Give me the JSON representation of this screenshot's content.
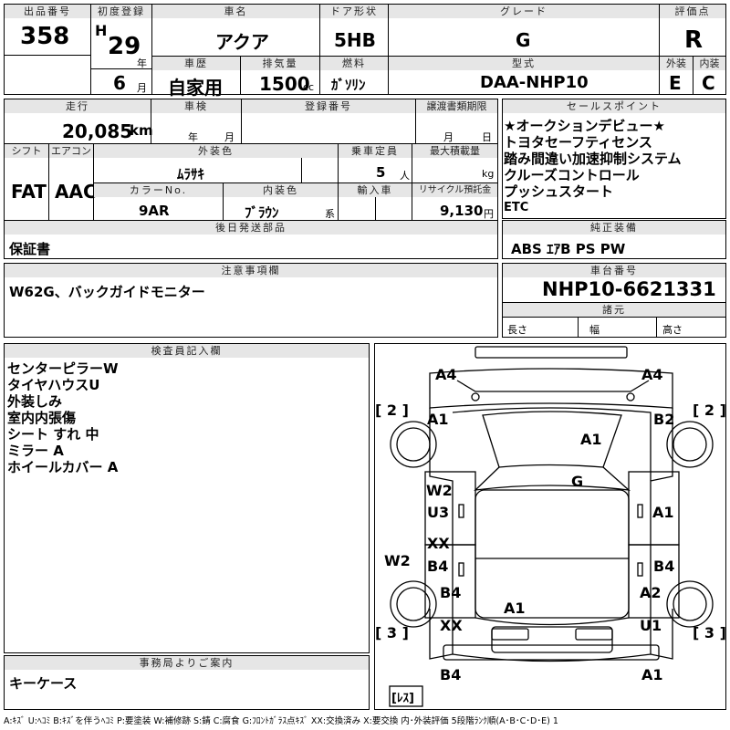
{
  "top": {
    "lot_label": "出品番号",
    "lot_value": "358",
    "first_reg_label": "初度登録",
    "era": "H",
    "year": "29",
    "year_unit": "年",
    "month": "6",
    "month_unit": "月",
    "car_name_label": "車名",
    "car_name": "アクア",
    "door_label": "ドア形状",
    "door": "5HB",
    "grade_label": "グレード",
    "grade": "G",
    "score_label": "評価点",
    "score": "R",
    "history_label": "車歴",
    "history": "自家用",
    "displacement_label": "排気量",
    "displacement": "1500",
    "displacement_unit": "cc",
    "fuel_label": "燃料",
    "fuel": "ｶﾞｿﾘﾝ",
    "model_label": "型式",
    "model": "DAA-NHP10",
    "exterior_label": "外装",
    "exterior": "E",
    "interior_label": "内装",
    "interior": "C"
  },
  "second": {
    "mileage_label": "走行",
    "mileage": "20,085",
    "mileage_unit": "km",
    "inspection_label": "車検",
    "inspection_year_unit": "年",
    "inspection_month_unit": "月",
    "reg_no_label": "登録番号",
    "transfer_label": "譲渡書類期限",
    "transfer_month_unit": "月",
    "transfer_day_unit": "日",
    "shift_label": "シフト",
    "shift": "FAT",
    "ac_label": "エアコン",
    "ac": "AAC",
    "ext_color_label": "外装色",
    "ext_color": "ﾑﾗｻｷ",
    "capacity_label": "乗車定員",
    "capacity": "5",
    "capacity_unit": "人",
    "max_load_label": "最大積載量",
    "max_load_unit": "kg",
    "color_no_label": "カラーNo.",
    "color_no": "9AR",
    "int_color_label": "内装色",
    "int_color": "ﾌﾞﾗｳﾝ",
    "int_color_unit": "系",
    "import_label": "輸入車",
    "recycle_label": "リサイクル預託金",
    "recycle": "9,130",
    "recycle_unit": "円",
    "later_label": "後日発送部品",
    "later": "保証書"
  },
  "sales": {
    "label": "セールスポイント",
    "lines": [
      "★オークションデビュー★",
      "トヨタセーフティセンス",
      "踏み間違い加速抑制システム",
      "クルーズコントロール",
      "プッシュスタート",
      "ETC"
    ]
  },
  "equipment": {
    "label": "純正装備",
    "value": "ABS ｴｱB PS PW"
  },
  "notes": {
    "label": "注意事項欄",
    "value": "W62G、バックガイドモニター"
  },
  "chassis": {
    "label": "車台番号",
    "value": "NHP10-6621331",
    "dim_label": "諸元",
    "length": "長さ",
    "width": "幅",
    "height": "高さ"
  },
  "inspector": {
    "label": "検査員記入欄",
    "lines": [
      "センターピラーW",
      "タイヤハウスU",
      "外装しみ",
      "室内内張傷",
      "シート すれ 中",
      "ミラー A",
      "ホイールカバー A"
    ]
  },
  "office": {
    "label": "事務局よりご案内",
    "value": "キーケース"
  },
  "legend": "A:ｷｽﾞ U:ﾍｺﾐ B:ｷｽﾞを伴うﾍｺﾐ P:要塗装 W:補修跡 S:錆 C:腐食 G:ﾌﾛﾝﾄｶﾞﾗｽ点ｷｽﾞ XX:交換済み X:要交換 内･外装評価 5段階ﾗﾝｸ順(A･B･C･D･E) 1",
  "diagram": {
    "front_left": "A4",
    "front_right": "A4",
    "tire_fl": "[ 2 ]",
    "tire_fr": "[ 2 ]",
    "tire_rl": "[ 3 ]",
    "tire_rr": "[ 3 ]",
    "fender_fl": "A1",
    "fender_fr": "B2",
    "hood": "A1",
    "windshield": "G",
    "door_fl_1": "W2",
    "door_fl_2": "U3",
    "door_fr": "A1",
    "door_rl_1": "XX",
    "door_rl_2": "B4",
    "pillar_l": "W2",
    "door_rr": "B4",
    "quarter_rl": "B4",
    "quarter_rr": "A2",
    "roof_rear": "A1",
    "rear_l": "XX",
    "rear_r": "U1",
    "bumper_rl": "B4",
    "bumper_rr": "A1",
    "spare_label": "[ﾚｽ]"
  }
}
